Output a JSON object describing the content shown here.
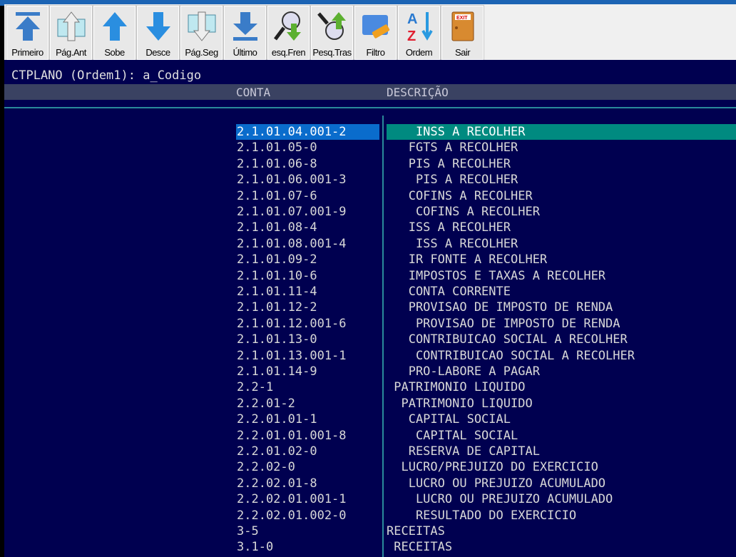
{
  "toolbar": [
    {
      "label": "Primeiro",
      "icon": "first-icon"
    },
    {
      "label": "Pág.Ant",
      "icon": "page-up-icon"
    },
    {
      "label": "Sobe",
      "icon": "arrow-up-icon"
    },
    {
      "label": "Desce",
      "icon": "arrow-down-icon"
    },
    {
      "label": "Pág.Seg",
      "icon": "page-down-icon"
    },
    {
      "label": "Último",
      "icon": "last-icon"
    },
    {
      "label": "esq.Fren",
      "icon": "search-forward-icon"
    },
    {
      "label": "Pesq.Tras",
      "icon": "search-back-icon"
    },
    {
      "label": "Filtro",
      "icon": "filter-icon"
    },
    {
      "label": "Ordem",
      "icon": "sort-az-icon"
    },
    {
      "label": "Sair",
      "icon": "exit-door-icon"
    }
  ],
  "title": "CTPLANO (Ordem1): a_Codigo",
  "columns": {
    "conta": "CONTA",
    "descricao": "DESCRIÇÃO"
  },
  "colors": {
    "selected_code": "#0a6ccc",
    "selected_desc": "#008a80",
    "background": "#000050"
  },
  "selected_index": 0,
  "rows": [
    {
      "conta": "2.1.01.04.001-2",
      "descricao": "    INSS A RECOLHER"
    },
    {
      "conta": "2.1.01.05-0",
      "descricao": "   FGTS A RECOLHER"
    },
    {
      "conta": "2.1.01.06-8",
      "descricao": "   PIS A RECOLHER"
    },
    {
      "conta": "2.1.01.06.001-3",
      "descricao": "    PIS A RECOLHER"
    },
    {
      "conta": "2.1.01.07-6",
      "descricao": "   COFINS A RECOLHER"
    },
    {
      "conta": "2.1.01.07.001-9",
      "descricao": "    COFINS A RECOLHER"
    },
    {
      "conta": "2.1.01.08-4",
      "descricao": "   ISS A RECOLHER"
    },
    {
      "conta": "2.1.01.08.001-4",
      "descricao": "    ISS A RECOLHER"
    },
    {
      "conta": "2.1.01.09-2",
      "descricao": "   IR FONTE A RECOLHER"
    },
    {
      "conta": "2.1.01.10-6",
      "descricao": "   IMPOSTOS E TAXAS A RECOLHER"
    },
    {
      "conta": "2.1.01.11-4",
      "descricao": "   CONTA CORRENTE"
    },
    {
      "conta": "2.1.01.12-2",
      "descricao": "   PROVISAO DE IMPOSTO DE RENDA"
    },
    {
      "conta": "2.1.01.12.001-6",
      "descricao": "    PROVISAO DE IMPOSTO DE RENDA"
    },
    {
      "conta": "2.1.01.13-0",
      "descricao": "   CONTRIBUICAO SOCIAL A RECOLHER"
    },
    {
      "conta": "2.1.01.13.001-1",
      "descricao": "    CONTRIBUICAO SOCIAL A RECOLHER"
    },
    {
      "conta": "2.1.01.14-9",
      "descricao": "   PRO-LABORE A PAGAR"
    },
    {
      "conta": "2.2-1",
      "descricao": " PATRIMONIO LIQUIDO"
    },
    {
      "conta": "2.2.01-2",
      "descricao": "  PATRIMONIO LIQUIDO"
    },
    {
      "conta": "2.2.01.01-1",
      "descricao": "   CAPITAL SOCIAL"
    },
    {
      "conta": "2.2.01.01.001-8",
      "descricao": "    CAPITAL SOCIAL"
    },
    {
      "conta": "2.2.01.02-0",
      "descricao": "   RESERVA DE CAPITAL"
    },
    {
      "conta": "2.2.02-0",
      "descricao": "  LUCRO/PREJUIZO DO EXERCICIO"
    },
    {
      "conta": "2.2.02.01-8",
      "descricao": "   LUCRO OU PREJUIZO ACUMULADO"
    },
    {
      "conta": "2.2.02.01.001-1",
      "descricao": "    LUCRO OU PREJUIZO ACUMULADO"
    },
    {
      "conta": "2.2.02.01.002-0",
      "descricao": "    RESULTADO DO EXERCICIO"
    },
    {
      "conta": "3-5",
      "descricao": "RECEITAS"
    },
    {
      "conta": "3.1-0",
      "descricao": " RECEITAS"
    }
  ]
}
